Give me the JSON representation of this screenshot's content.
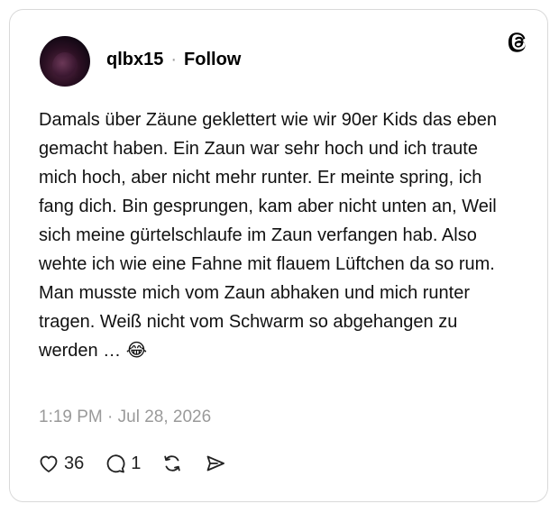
{
  "post": {
    "username": "qlbx15",
    "separator": "·",
    "follow_label": "Follow",
    "text": "Damals über Zäune geklettert wie wir 90er Kids das eben gemacht haben. Ein Zaun war sehr hoch und ich traute mich hoch, aber nicht mehr runter. Er meinte spring, ich fang dich. Bin gesprungen, kam aber nicht unten an, Weil sich meine gürtelschlaufe im Zaun verfangen hab. Also wehte ich wie eine Fahne mit flauem Lüftchen da so rum. Man musste mich vom Zaun abhaken und mich runter tragen. Weiß nicht vom Schwarm so abgehangen zu werden … 😂",
    "timestamp": "1:19 PM · Jul 28, 2026"
  },
  "actions": {
    "like_count": "36",
    "reply_count": "1",
    "icons": [
      "heart-icon",
      "comment-icon",
      "repost-icon",
      "share-icon"
    ]
  },
  "colors": {
    "border": "#d9d9d9",
    "muted": "#9a9a9a",
    "text": "#111111"
  }
}
